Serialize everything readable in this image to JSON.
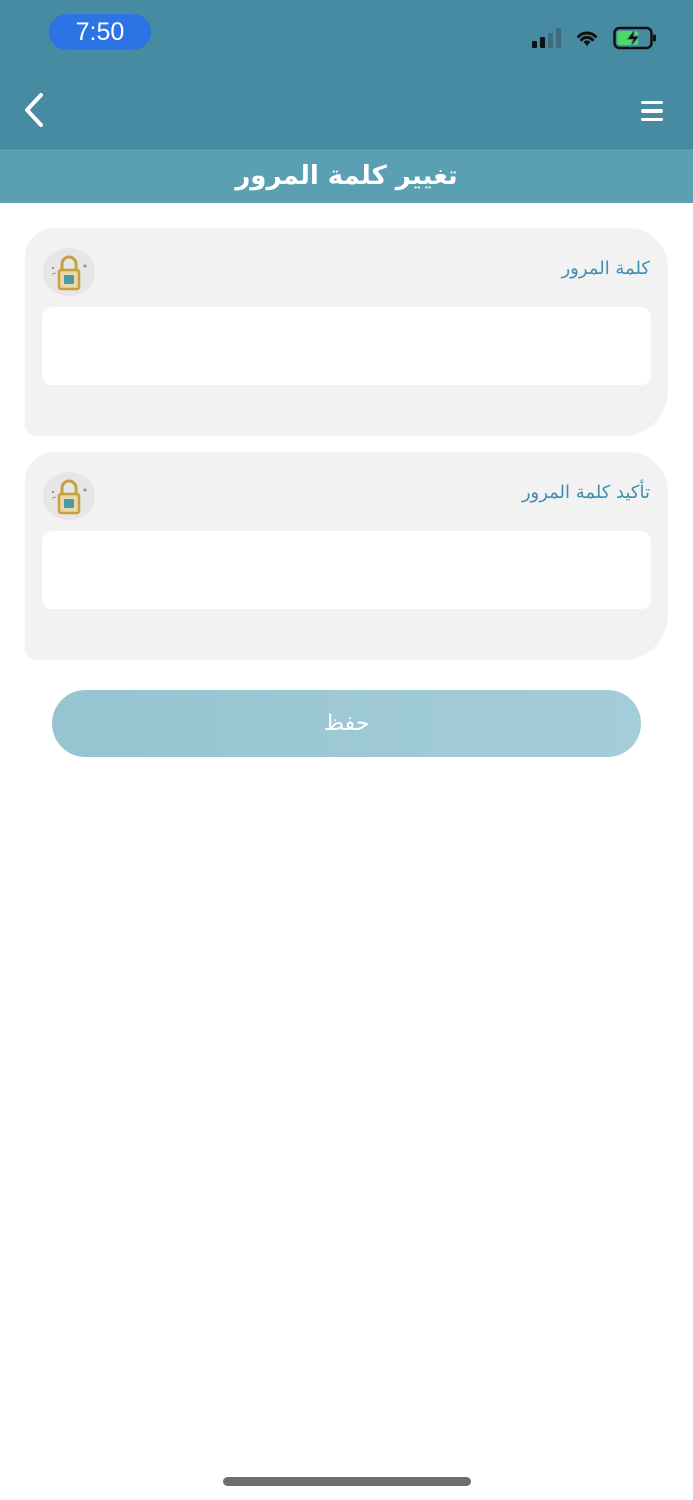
{
  "status_bar": {
    "time": "7:50",
    "icons": [
      "cellular-signal-icon",
      "wifi-icon",
      "battery-charging-icon"
    ]
  },
  "header": {
    "back_icon": "chevron-left-icon",
    "menu_icon": "hamburger-menu-icon",
    "title": "تغيير كلمة المرور"
  },
  "form": {
    "password": {
      "label": "كلمة المرور",
      "value": "",
      "icon": "padlock-icon"
    },
    "confirm_password": {
      "label": "تأكيد كلمة المرور",
      "value": "",
      "icon": "padlock-icon"
    },
    "save_label": "حفظ"
  },
  "colors": {
    "header_bg": "#468ba2",
    "title_bar_bg": "#5b9fb2",
    "label_color": "#3f8fb0",
    "lock_gold": "#c7a13f",
    "lock_teal": "#4a9aa8",
    "button_bg": "#9dc8d4"
  }
}
